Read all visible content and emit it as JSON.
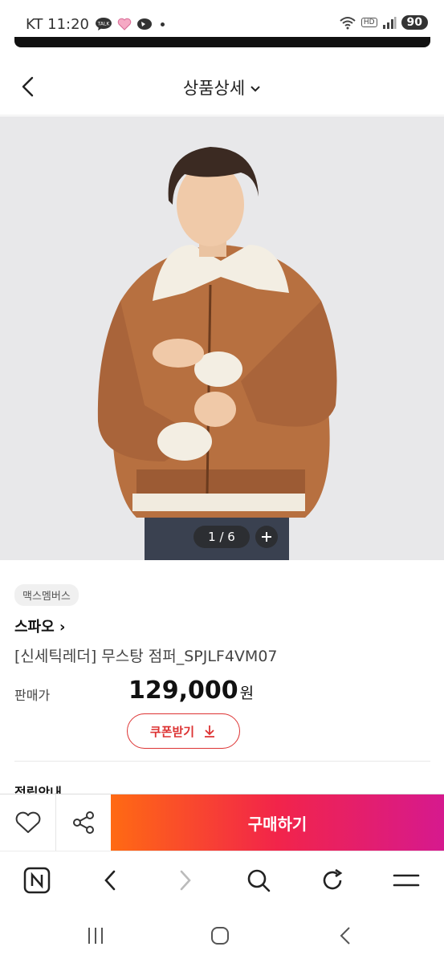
{
  "status_bar": {
    "carrier_time": "KT 11:20",
    "talk_badge": "TALK",
    "hd_badge": "HD",
    "battery": "90"
  },
  "header": {
    "title": "상품상세"
  },
  "gallery": {
    "counter": "1 / 6"
  },
  "product": {
    "mall_badge": "맥스멤버스",
    "brand": "스파오 ›",
    "name": "[신세틱레더] 무스탕 점퍼_SPJLF4VM07",
    "price_label": "판매가",
    "price": "129,000",
    "price_unit": "원",
    "coupon_label": "쿠폰받기",
    "next_section": "적립안내"
  },
  "buy_bar": {
    "buy_label": "구매하기"
  },
  "colors": {
    "accent": "#d33333",
    "buy_gradient_start": "#ff6a13",
    "buy_gradient_end": "#d6198e"
  }
}
